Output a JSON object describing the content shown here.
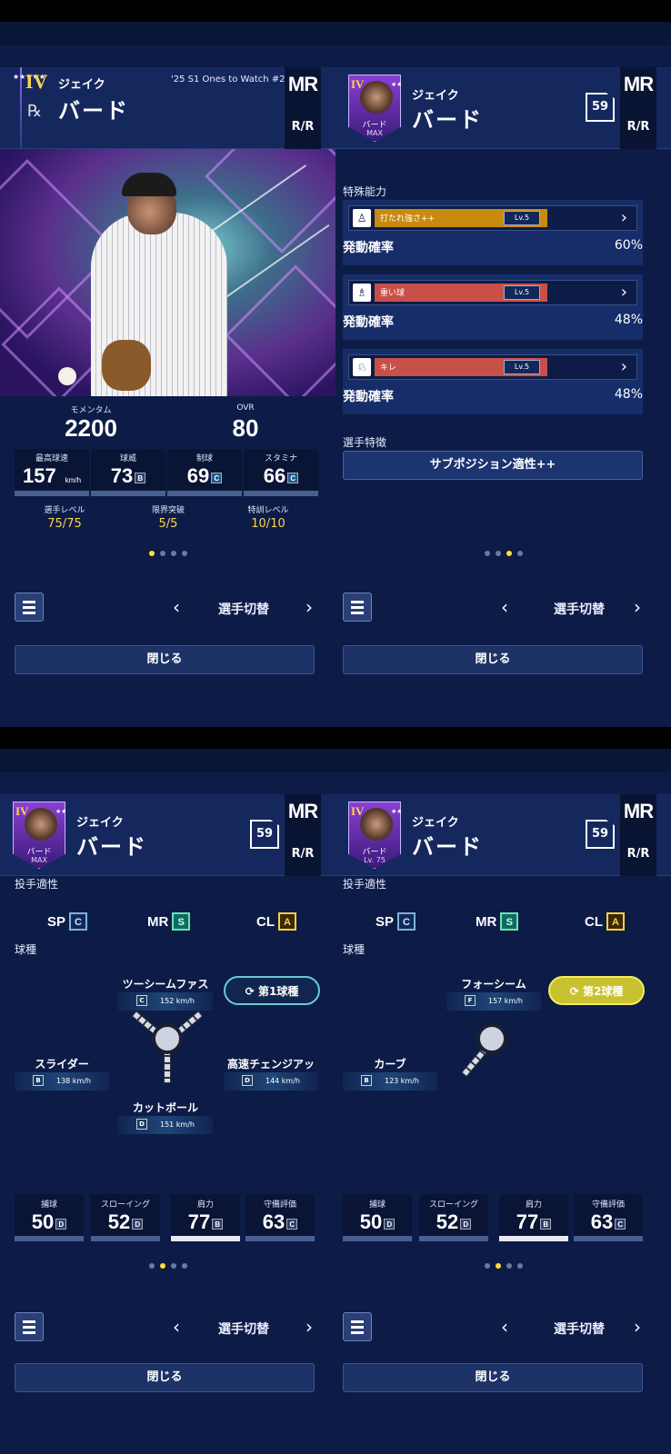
{
  "player": {
    "first": "ジェイク",
    "last": "バード",
    "position": "MR",
    "hand": "R/R",
    "number": "59",
    "series": "'25 S1 Ones to Watch #2",
    "grade": "IV",
    "card_sub_max": "MAX",
    "card_sub_lv": "Lv. 75",
    "stars": "★★★★★"
  },
  "overview": {
    "momentum_label": "モメンタム",
    "momentum": "2200",
    "ovr_label": "OVR",
    "ovr": "80",
    "stats": [
      {
        "label": "最高球速",
        "value": "157",
        "unit": "km/h",
        "grade": ""
      },
      {
        "label": "球威",
        "value": "73",
        "grade": "B"
      },
      {
        "label": "制球",
        "value": "69",
        "grade": "C"
      },
      {
        "label": "スタミナ",
        "value": "66",
        "grade": "C"
      }
    ],
    "levels": [
      {
        "label": "選手レベル",
        "value": "75/75"
      },
      {
        "label": "限界突破",
        "value": "5/5"
      },
      {
        "label": "特訓レベル",
        "value": "10/10"
      }
    ]
  },
  "abilities": {
    "title": "特殊能力",
    "prob_label": "発動確率",
    "items": [
      {
        "name": "打たれ強さ++",
        "lv": "Lv.5",
        "pct": "60%",
        "color": "#c98a10"
      },
      {
        "name": "重い球",
        "lv": "Lv.5",
        "pct": "48%",
        "color": "#c85048"
      },
      {
        "name": "キレ",
        "lv": "Lv.5",
        "pct": "48%",
        "color": "#c85048"
      }
    ],
    "trait_title": "選手特徴",
    "trait": "サブポジション適性++"
  },
  "aptitude": {
    "title": "投手適性",
    "items": [
      {
        "pos": "SP",
        "grade": "C"
      },
      {
        "pos": "MR",
        "grade": "S"
      },
      {
        "pos": "CL",
        "grade": "A"
      }
    ],
    "pitch_title": "球種"
  },
  "pitches1": {
    "badge": "第1球種",
    "items": [
      {
        "name": "ツーシームファスト",
        "grade": "C",
        "speed": "152 km/h"
      },
      {
        "name": "スライダー",
        "grade": "B",
        "speed": "138 km/h"
      },
      {
        "name": "高速チェンジアップ",
        "grade": "D",
        "speed": "144 km/h"
      },
      {
        "name": "カットボール",
        "grade": "D",
        "speed": "151 km/h"
      }
    ]
  },
  "pitches2": {
    "badge": "第2球種",
    "items": [
      {
        "name": "フォーシーム",
        "grade": "F",
        "speed": "157 km/h"
      },
      {
        "name": "カーブ",
        "grade": "B",
        "speed": "123 km/h"
      }
    ]
  },
  "fielding": [
    {
      "label": "捕球",
      "value": "50",
      "grade": "D"
    },
    {
      "label": "スローイング",
      "value": "52",
      "grade": "D"
    },
    {
      "label": "肩力",
      "value": "77",
      "grade": "B"
    },
    {
      "label": "守備評価",
      "value": "63",
      "grade": "C"
    }
  ],
  "nav": {
    "switch": "選手切替",
    "close": "閉じる",
    "prev": "‹",
    "next": "›"
  }
}
